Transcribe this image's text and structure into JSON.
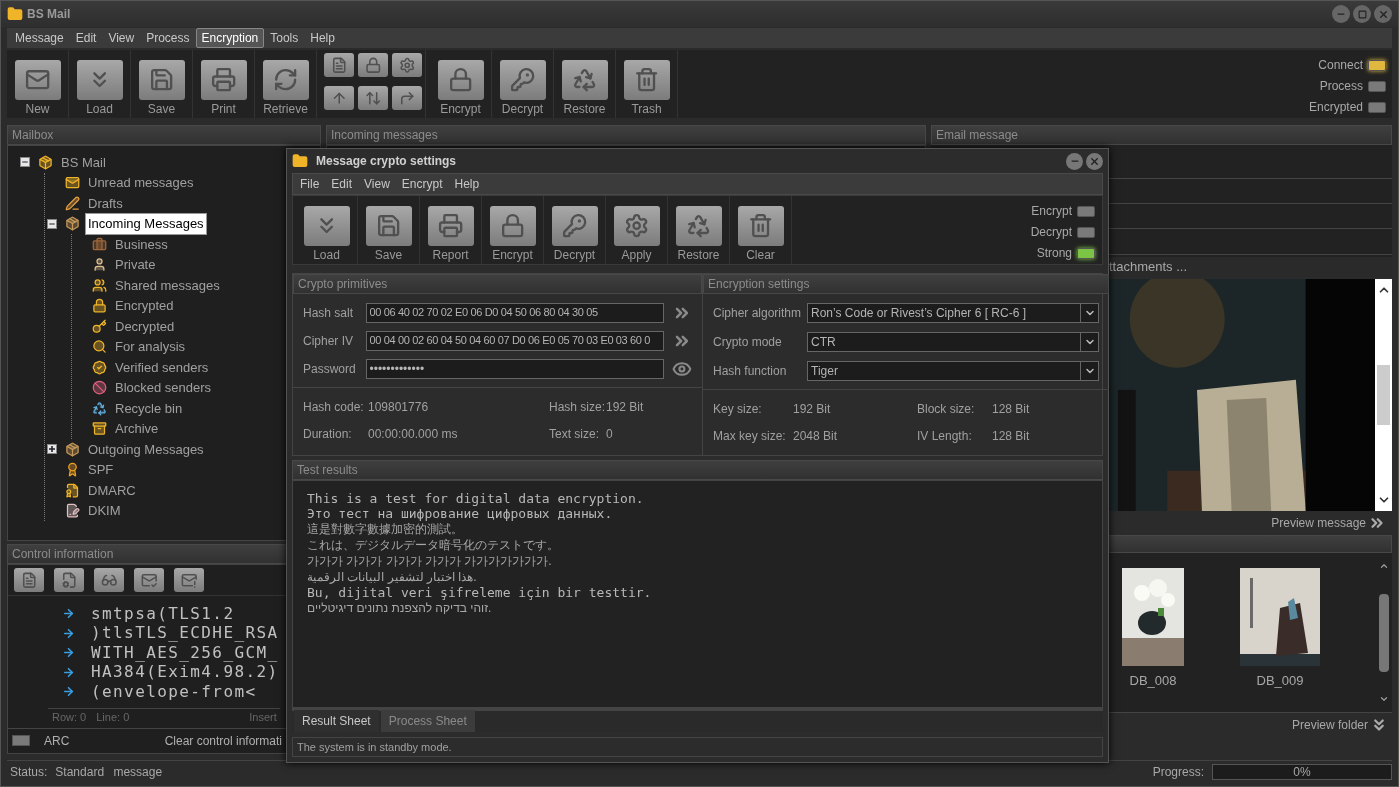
{
  "window": {
    "title": "BS Mail"
  },
  "menu": [
    {
      "label": "Message",
      "selected": false
    },
    {
      "label": "Edit",
      "selected": false
    },
    {
      "label": "View",
      "selected": false
    },
    {
      "label": "Process",
      "selected": false
    },
    {
      "label": "Encryption",
      "selected": true
    },
    {
      "label": "Tools",
      "selected": false
    },
    {
      "label": "Help",
      "selected": false
    }
  ],
  "toolbar": [
    {
      "kind": "button",
      "label": "New"
    },
    {
      "kind": "button",
      "label": "Load"
    },
    {
      "kind": "button",
      "label": "Save"
    },
    {
      "kind": "button",
      "label": "Print"
    },
    {
      "kind": "button",
      "label": "Retrieve"
    },
    {
      "kind": "grid"
    },
    {
      "kind": "button",
      "label": "Encrypt"
    },
    {
      "kind": "button",
      "label": "Decrypt"
    },
    {
      "kind": "button",
      "label": "Restore"
    },
    {
      "kind": "button",
      "label": "Trash"
    }
  ],
  "indicators": [
    {
      "label": "Connect",
      "on": true,
      "color": "#e0b840"
    },
    {
      "label": "Process",
      "on": false
    },
    {
      "label": "Encrypted",
      "on": false
    }
  ],
  "mailbox": {
    "title": "Mailbox",
    "tree": [
      {
        "label": "BS Mail",
        "expanded": true,
        "selected": false,
        "children": [
          {
            "label": "Unread messages",
            "selected": false
          },
          {
            "label": "Drafts",
            "selected": false
          },
          {
            "label": "Incoming Messages",
            "expanded": true,
            "selected": true,
            "children": [
              {
                "label": "Business",
                "selected": false
              },
              {
                "label": "Private",
                "selected": false
              },
              {
                "label": "Shared messages",
                "selected": false
              },
              {
                "label": "Encrypted",
                "selected": false
              },
              {
                "label": "Decrypted",
                "selected": false
              },
              {
                "label": "For analysis",
                "selected": false
              },
              {
                "label": "Verified senders",
                "selected": false
              },
              {
                "label": "Blocked senders",
                "selected": false
              },
              {
                "label": "Recycle bin",
                "selected": false
              },
              {
                "label": "Archive",
                "selected": false
              }
            ]
          },
          {
            "label": "Outgoing Messages",
            "expanded": false,
            "selected": false
          },
          {
            "label": "SPF",
            "selected": false
          },
          {
            "label": "DMARC",
            "selected": false
          },
          {
            "label": "DKIM",
            "selected": false
          }
        ]
      }
    ]
  },
  "control_info": {
    "title": "Control information",
    "lines": [
      "smtpsa(TLS1.2",
      ")tlsTLS_ECDHE_RSA",
      "WITH_AES_256_GCM_",
      "HA384(Exim4.98.2)",
      "(envelope-from<"
    ],
    "row": "Row: 0",
    "line": "Line: 0",
    "mode": "Insert",
    "arc": {
      "label": "ARC",
      "on": false
    },
    "clear": "Clear control informati"
  },
  "incoming": {
    "title": "Incoming messages"
  },
  "email": {
    "title": "Email message",
    "attachments": "ttachments ...",
    "preview_message": "Preview message",
    "thumbnails": [
      {
        "name": "DB_008"
      },
      {
        "name": "DB_009"
      }
    ],
    "preview_folder": "Preview folder"
  },
  "status_bar": {
    "label": "Status:",
    "value": "Standard message",
    "progress_label": "Progress:",
    "progress": {
      "level": 0,
      "reading": "0%"
    }
  },
  "dialog": {
    "title": "Message crypto settings",
    "menu": [
      "File",
      "Edit",
      "View",
      "Encrypt",
      "Help"
    ],
    "toolbar": [
      "Load",
      "Save",
      "Report",
      "Encrypt",
      "Decrypt",
      "Apply",
      "Restore",
      "Clear"
    ],
    "indicators": [
      {
        "label": "Encrypt",
        "on": false
      },
      {
        "label": "Decrypt",
        "on": false
      },
      {
        "label": "Strong",
        "on": true,
        "color": "#7cc444"
      }
    ],
    "primitives": {
      "title": "Crypto primitives",
      "fields": [
        {
          "kind": "hex",
          "label": "Hash salt",
          "value": "00 06 40 02 70 02 E0 06 D0 04 50 06 80 04 30 05"
        },
        {
          "kind": "hex",
          "label": "Cipher IV",
          "value": "00 04 00 02 60 04 50 04 60 07 D0 06 E0 05 70 03 E0 03 60 0"
        },
        {
          "kind": "password",
          "label": "Password",
          "value": "•••••••••••••"
        }
      ],
      "stats": [
        {
          "label": "Hash code:",
          "value": "109801776"
        },
        {
          "label": "Hash size:",
          "value": "192 Bit"
        },
        {
          "label": "Duration:",
          "value": "00:00:00.000 ms"
        },
        {
          "label": "Text size:",
          "value": "0"
        }
      ]
    },
    "settings": {
      "title": "Encryption settings",
      "selects": [
        {
          "label": "Cipher algorithm",
          "value": "Ron’s Code or Rivest’s Cipher 6 [ RC-6 ]"
        },
        {
          "label": "Crypto mode",
          "value": "CTR"
        },
        {
          "label": "Hash function",
          "value": "Tiger"
        }
      ],
      "stats": [
        {
          "label": "Key size:",
          "value": "192 Bit"
        },
        {
          "label": "Block size:",
          "value": "128 Bit"
        },
        {
          "label": "Max key size:",
          "value": "2048 Bit"
        },
        {
          "label": "IV Length:",
          "value": "128 Bit"
        }
      ]
    },
    "results": {
      "title": "Test results",
      "lines": [
        {
          "kind": "mono",
          "text": "This is a test for digital data encryption."
        },
        {
          "kind": "mono",
          "text": "Это тест на шифрование цифровых данных."
        },
        {
          "kind": "plain",
          "text": "這是對數字數據加密的測試。"
        },
        {
          "kind": "plain",
          "text": "これは、デジタルデータ暗号化のテストです。"
        },
        {
          "kind": "plain",
          "text": "가가가 가가가 가가가 가가가 가가가가가가가."
        },
        {
          "kind": "plain",
          "text": "هذا اختبار لتشفير البيانات الرقمية."
        },
        {
          "kind": "mono",
          "text": "Bu, dijital veri şifreleme için bir testtir."
        },
        {
          "kind": "plain",
          "text": "זוהי בדיקה להצפנת נתונים דיגיטליים."
        }
      ]
    },
    "tabs": [
      {
        "label": "Result Sheet",
        "selected": true
      },
      {
        "label": "Process Sheet",
        "selected": false
      }
    ],
    "status": "The system is in standby mode."
  }
}
